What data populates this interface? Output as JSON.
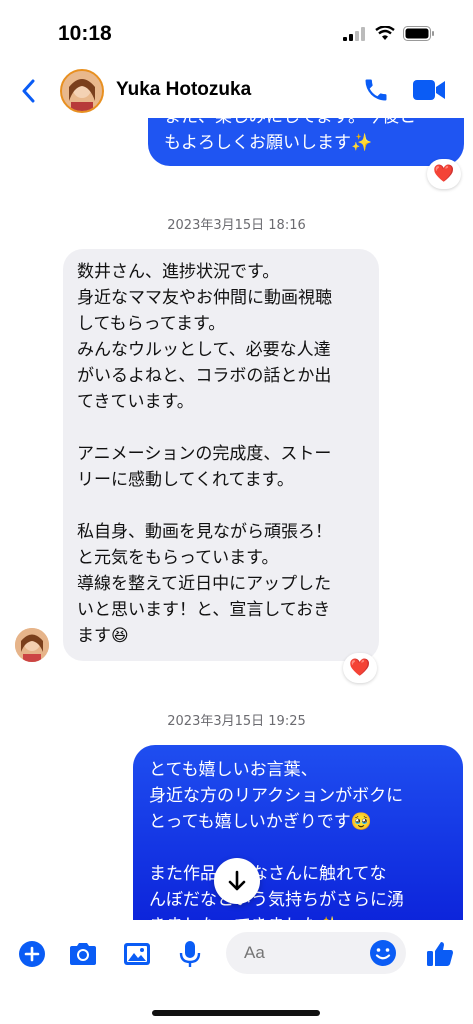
{
  "status": {
    "time": "10:18"
  },
  "header": {
    "contact_name": "Yuka Hotozuka"
  },
  "messages": {
    "prev_out_text": "また、楽しみにしてます。今後と\nもよろしくお願いします✨",
    "timestamp_1": "2023年3月15日 18:16",
    "in_text": "数井さん、進捗状況です。\n身近なママ友やお仲間に動画視聴\nしてもらってます。\nみんなウルッとして、必要な人達\nがいるよねと、コラボの話とか出\nてきています。\n\nアニメーションの完成度、ストー\nリーに感動してくれてます。\n\n私自身、動画を見ながら頑張ろ！\nと元気をもらっています。\n導線を整えて近日中にアップした\nいと思います！と、宣言しておき\nます😆",
    "timestamp_2": "2023年3月15日 19:25",
    "out_text": "とても嬉しいお言葉、\n身近な方のリアクションがボクに\nとっても嬉しいかぎりです🥹\n\nまた作品でみなさんに触れてな\nんぼだなという気持ちがさらに湧\nきました。てきました✨",
    "reaction": "❤️"
  },
  "composer": {
    "placeholder": "Aa"
  },
  "colors": {
    "accent": "#0a5cf5",
    "bubble_out_top": "#1f4ef0",
    "bubble_out_bottom": "#0a1fd8",
    "bubble_in": "#efeff3"
  },
  "icons": [
    "back-chevron-icon",
    "phone-icon",
    "video-camera-icon",
    "plus-circle-icon",
    "camera-icon",
    "gallery-icon",
    "microphone-icon",
    "emoji-icon",
    "thumbs-up-icon",
    "arrow-down-icon"
  ]
}
